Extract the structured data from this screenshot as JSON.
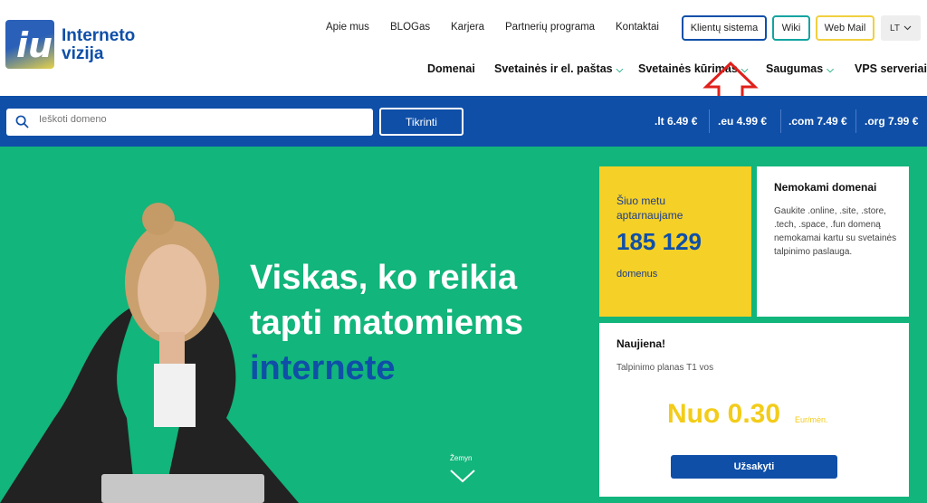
{
  "brand": {
    "logo_letter": "iu",
    "name_line1": "Interneto",
    "name_line2": "vizija"
  },
  "topnav": [
    "Apie mus",
    "BLOGas",
    "Karjera",
    "Partnerių programa",
    "Kontaktai"
  ],
  "top_buttons": {
    "client": "Klientų sistema",
    "wiki": "Wiki",
    "webmail": "Web Mail",
    "lang": "LT"
  },
  "mainnav": [
    {
      "label": "Domenai",
      "dropdown": false
    },
    {
      "label": "Svetainės ir el. paštas",
      "dropdown": true
    },
    {
      "label": "Svetainės kūrimas",
      "dropdown": true
    },
    {
      "label": "Saugumas",
      "dropdown": true
    },
    {
      "label": "VPS serveriai",
      "dropdown": false
    }
  ],
  "search": {
    "placeholder": "Ieškoti domeno",
    "button": "Tikrinti"
  },
  "prices": [
    ".lt 6.49 €",
    ".eu 4.99 €",
    ".com 7.49 €",
    ".org 7.99 €"
  ],
  "hero": {
    "line1": "Viskas, ko reikia",
    "line2": "tapti matomiems",
    "line3": "internete",
    "scroll_label": "Žemyn"
  },
  "stats_card": {
    "title": "Šiuo metu aptarnaujame",
    "number": "185 129",
    "unit": "domenus"
  },
  "domains_card": {
    "title": "Nemokami domenai",
    "text": "Gaukite .online, .site, .store, .tech, .space, .fun domeną nemokamai kartu su svetainės talpinimo paslauga."
  },
  "news_card": {
    "title": "Naujiena!",
    "subtitle": "Talpinimo planas T1 vos",
    "price": "Nuo 0.30",
    "unit": "Eur/mėn.",
    "button": "Užsakyti"
  },
  "colors": {
    "brand_blue": "#0f4fa8",
    "hero_green": "#12b57b",
    "accent_yellow": "#f5d026",
    "arrow_red": "#e0201c"
  }
}
